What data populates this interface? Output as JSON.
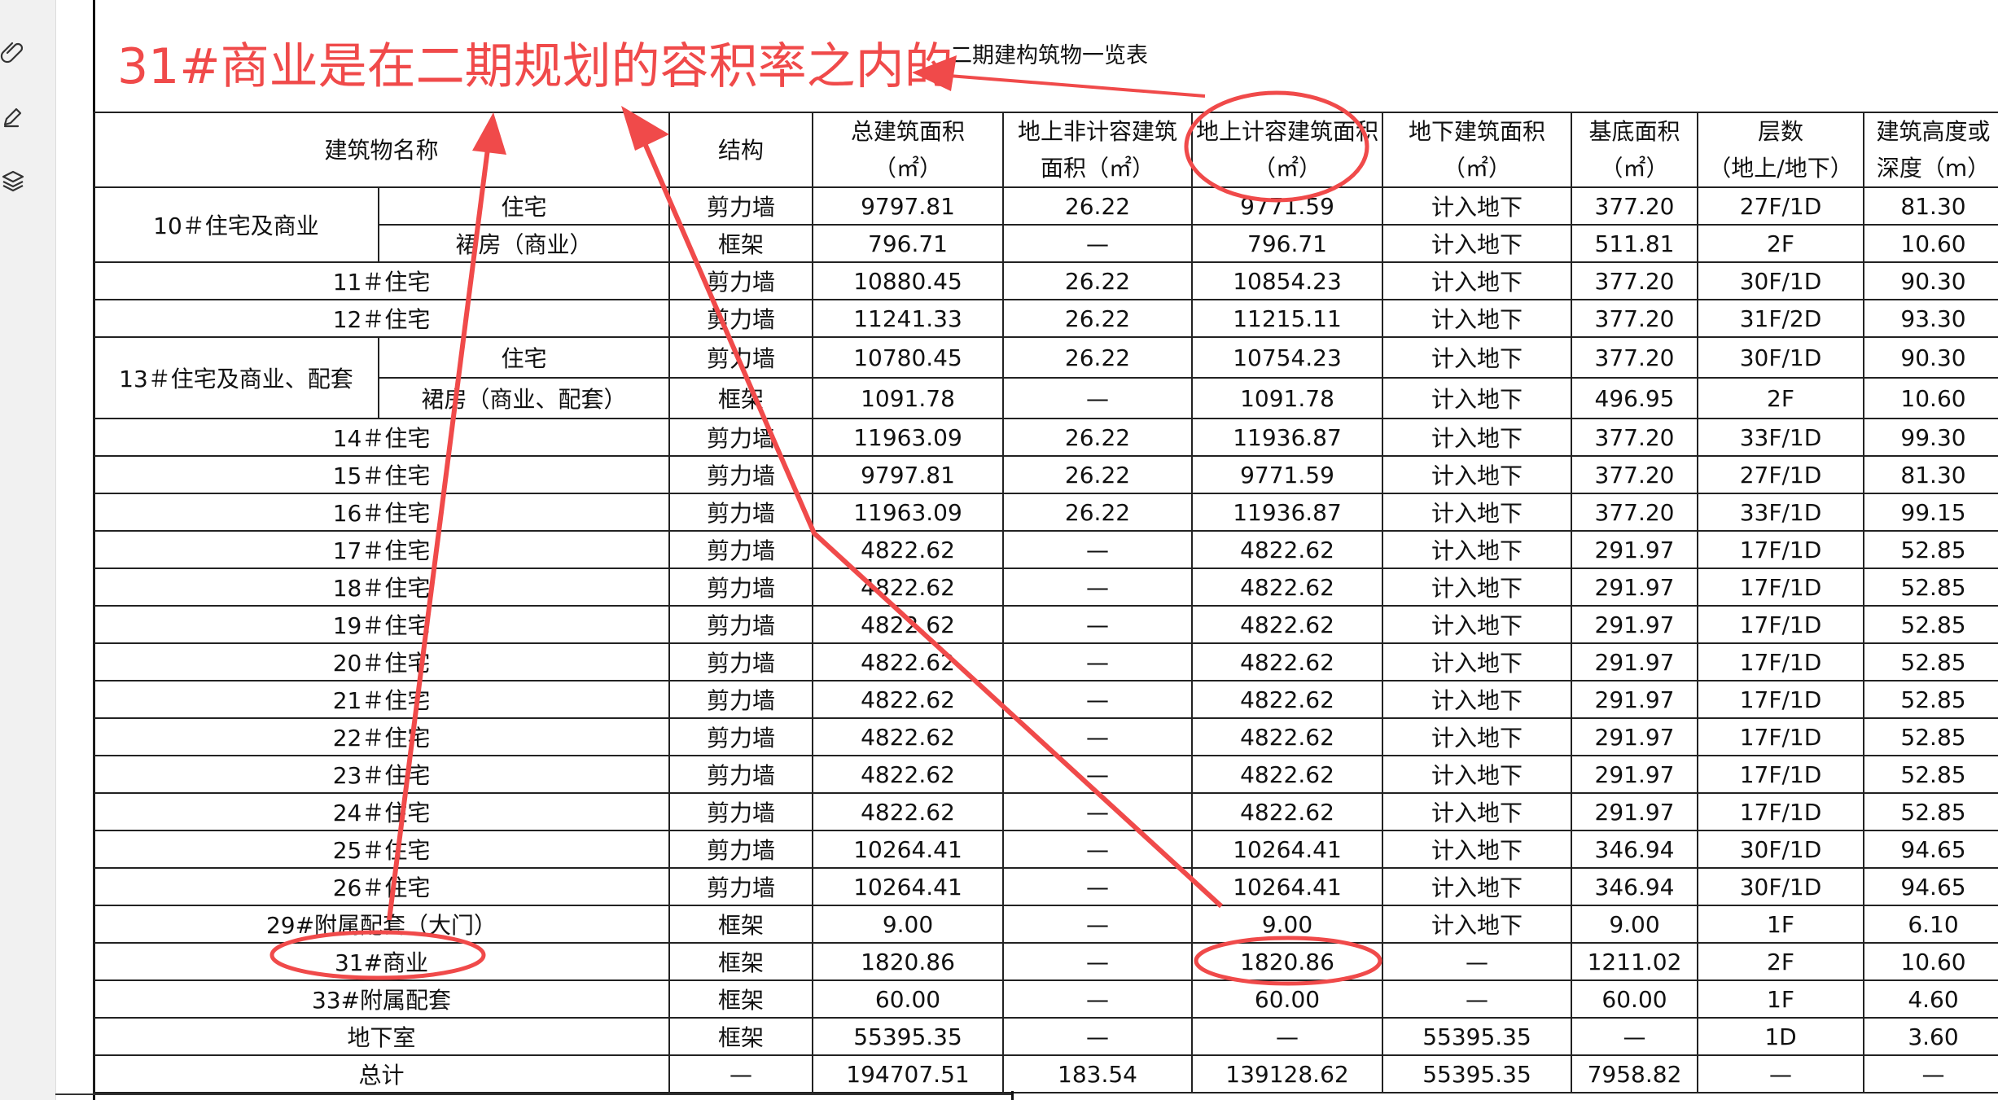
{
  "document": {
    "title": "二期建构筑物一览表"
  },
  "annotation": {
    "text": "31#商业是在二期规划的容积率之内的",
    "color": "#f04a4a"
  },
  "toolbar": {
    "icons": [
      "attachment-icon",
      "pen-icon",
      "layers-icon"
    ]
  },
  "table": {
    "headers": [
      {
        "line1": "建筑物名称",
        "line2": ""
      },
      {
        "line1": "结构",
        "line2": ""
      },
      {
        "line1": "总建筑面积",
        "line2": "（㎡）"
      },
      {
        "line1": "地上非计容建筑",
        "line2": "面积（㎡）"
      },
      {
        "line1": "地上计容建筑面积",
        "line2": "（㎡）"
      },
      {
        "line1": "地下建筑面积",
        "line2": "（㎡）"
      },
      {
        "line1": "基底面积",
        "line2": "（㎡）"
      },
      {
        "line1": "层数",
        "line2": "（地上/地下）"
      },
      {
        "line1": "建筑高度或",
        "line2": "深度（m）"
      }
    ],
    "group_10": {
      "name": "10＃住宅及商业",
      "rows": [
        {
          "sub": "住宅",
          "structure": "剪力墙",
          "total": "9797.81",
          "above_non": "26.22",
          "above_far": "9771.59",
          "under": "计入地下",
          "base": "377.20",
          "floors": "27F/1D",
          "height": "81.30"
        },
        {
          "sub": "裙房（商业）",
          "structure": "框架",
          "total": "796.71",
          "above_non": "—",
          "above_far": "796.71",
          "under": "计入地下",
          "base": "511.81",
          "floors": "2F",
          "height": "10.60"
        }
      ]
    },
    "group_13": {
      "name": "13＃住宅及商业、配套",
      "rows": [
        {
          "sub": "住宅",
          "structure": "剪力墙",
          "total": "10780.45",
          "above_non": "26.22",
          "above_far": "10754.23",
          "under": "计入地下",
          "base": "377.20",
          "floors": "30F/1D",
          "height": "90.30"
        },
        {
          "sub": "裙房（商业、配套）",
          "structure": "框架",
          "total": "1091.78",
          "above_non": "—",
          "above_far": "1091.78",
          "under": "计入地下",
          "base": "496.95",
          "floors": "2F",
          "height": "10.60"
        }
      ]
    },
    "rows_b": [
      {
        "name": "11＃住宅",
        "structure": "剪力墙",
        "total": "10880.45",
        "above_non": "26.22",
        "above_far": "10854.23",
        "under": "计入地下",
        "base": "377.20",
        "floors": "30F/1D",
        "height": "90.30"
      },
      {
        "name": "12＃住宅",
        "structure": "剪力墙",
        "total": "11241.33",
        "above_non": "26.22",
        "above_far": "11215.11",
        "under": "计入地下",
        "base": "377.20",
        "floors": "31F/2D",
        "height": "93.30"
      }
    ],
    "rows_c": [
      {
        "name": "14＃住宅",
        "structure": "剪力墙",
        "total": "11963.09",
        "above_non": "26.22",
        "above_far": "11936.87",
        "under": "计入地下",
        "base": "377.20",
        "floors": "33F/1D",
        "height": "99.30"
      },
      {
        "name": "15＃住宅",
        "structure": "剪力墙",
        "total": "9797.81",
        "above_non": "26.22",
        "above_far": "9771.59",
        "under": "计入地下",
        "base": "377.20",
        "floors": "27F/1D",
        "height": "81.30"
      },
      {
        "name": "16＃住宅",
        "structure": "剪力墙",
        "total": "11963.09",
        "above_non": "26.22",
        "above_far": "11936.87",
        "under": "计入地下",
        "base": "377.20",
        "floors": "33F/1D",
        "height": "99.15"
      },
      {
        "name": "17＃住宅",
        "structure": "剪力墙",
        "total": "4822.62",
        "above_non": "—",
        "above_far": "4822.62",
        "under": "计入地下",
        "base": "291.97",
        "floors": "17F/1D",
        "height": "52.85"
      },
      {
        "name": "18＃住宅",
        "structure": "剪力墙",
        "total": "4822.62",
        "above_non": "—",
        "above_far": "4822.62",
        "under": "计入地下",
        "base": "291.97",
        "floors": "17F/1D",
        "height": "52.85"
      },
      {
        "name": "19＃住宅",
        "structure": "剪力墙",
        "total": "4822.62",
        "above_non": "—",
        "above_far": "4822.62",
        "under": "计入地下",
        "base": "291.97",
        "floors": "17F/1D",
        "height": "52.85"
      },
      {
        "name": "20＃住宅",
        "structure": "剪力墙",
        "total": "4822.62",
        "above_non": "—",
        "above_far": "4822.62",
        "under": "计入地下",
        "base": "291.97",
        "floors": "17F/1D",
        "height": "52.85"
      },
      {
        "name": "21＃住宅",
        "structure": "剪力墙",
        "total": "4822.62",
        "above_non": "—",
        "above_far": "4822.62",
        "under": "计入地下",
        "base": "291.97",
        "floors": "17F/1D",
        "height": "52.85"
      },
      {
        "name": "22＃住宅",
        "structure": "剪力墙",
        "total": "4822.62",
        "above_non": "—",
        "above_far": "4822.62",
        "under": "计入地下",
        "base": "291.97",
        "floors": "17F/1D",
        "height": "52.85"
      },
      {
        "name": "23＃住宅",
        "structure": "剪力墙",
        "total": "4822.62",
        "above_non": "—",
        "above_far": "4822.62",
        "under": "计入地下",
        "base": "291.97",
        "floors": "17F/1D",
        "height": "52.85"
      },
      {
        "name": "24＃住宅",
        "structure": "剪力墙",
        "total": "4822.62",
        "above_non": "—",
        "above_far": "4822.62",
        "under": "计入地下",
        "base": "291.97",
        "floors": "17F/1D",
        "height": "52.85"
      },
      {
        "name": "25＃住宅",
        "structure": "剪力墙",
        "total": "10264.41",
        "above_non": "—",
        "above_far": "10264.41",
        "under": "计入地下",
        "base": "346.94",
        "floors": "30F/1D",
        "height": "94.65"
      },
      {
        "name": "26＃住宅",
        "structure": "剪力墙",
        "total": "10264.41",
        "above_non": "—",
        "above_far": "10264.41",
        "under": "计入地下",
        "base": "346.94",
        "floors": "30F/1D",
        "height": "94.65"
      },
      {
        "name": "29#附属配套（大门）",
        "structure": "框架",
        "total": "9.00",
        "above_non": "—",
        "above_far": "9.00",
        "under": "计入地下",
        "base": "9.00",
        "floors": "1F",
        "height": "6.10"
      },
      {
        "name": "31#商业",
        "structure": "框架",
        "total": "1820.86",
        "above_non": "—",
        "above_far": "1820.86",
        "under": "—",
        "base": "1211.02",
        "floors": "2F",
        "height": "10.60"
      },
      {
        "name": "33#附属配套",
        "structure": "框架",
        "total": "60.00",
        "above_non": "—",
        "above_far": "60.00",
        "under": "—",
        "base": "60.00",
        "floors": "1F",
        "height": "4.60"
      },
      {
        "name": "地下室",
        "structure": "框架",
        "total": "55395.35",
        "above_non": "—",
        "above_far": "—",
        "under": "55395.35",
        "base": "—",
        "floors": "1D",
        "height": "3.60"
      },
      {
        "name": "总计",
        "structure": "—",
        "total": "194707.51",
        "above_non": "183.54",
        "above_far": "139128.62",
        "under": "55395.35",
        "base": "7958.82",
        "floors": "—",
        "height": "—"
      }
    ]
  }
}
